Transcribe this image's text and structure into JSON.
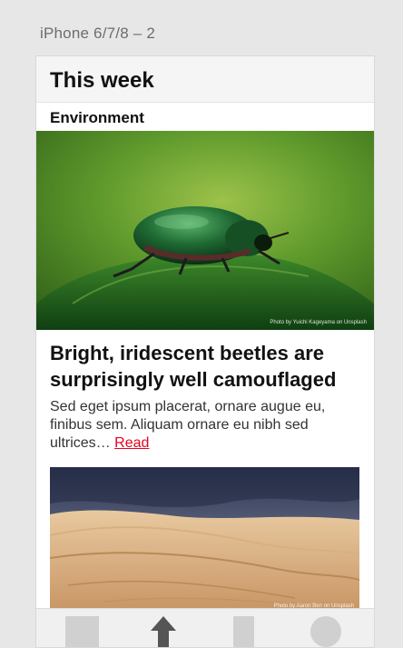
{
  "artboard": {
    "label": "iPhone 6/7/8 – 2"
  },
  "header": {
    "title": "This week"
  },
  "section": {
    "label": "Environment"
  },
  "hero": {
    "image_icon": "beetle-on-leaf-photo",
    "credit": "Photo by Yuichi Kageyama on Unsplash"
  },
  "article": {
    "headline": "Bright, iridescent beetles are surprisingly well camouflaged",
    "summary": "Sed eget ipsum placerat, ornare augue eu, finibus sem. Aliquam ornare eu nibh sed ultrices…",
    "read_label": "Read"
  },
  "second_card": {
    "image_icon": "desert-dunes-photo",
    "credit": "Photo by Aaron Ben on Unsplash"
  },
  "tab_bar": {
    "tabs": [
      {
        "icon": "square-icon"
      },
      {
        "icon": "arrow-up-icon"
      },
      {
        "icon": "rectangle-icon"
      },
      {
        "icon": "circle-icon"
      }
    ]
  },
  "colors": {
    "background": "#e7e7e7",
    "link": "#e8001f",
    "placeholder_shape": "#d0d0d0"
  }
}
